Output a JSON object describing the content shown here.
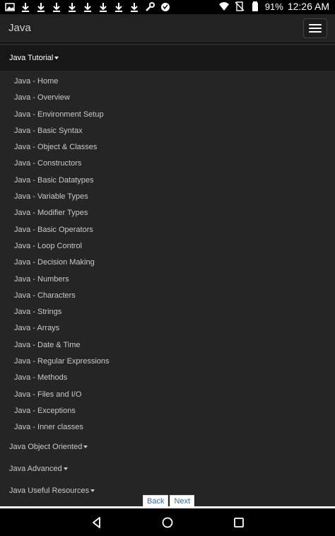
{
  "status_bar": {
    "battery": "91%",
    "time": "12:26 AM",
    "left_icons": [
      "image-icon",
      "download-icon",
      "download-icon",
      "download-icon",
      "download-icon",
      "download-icon",
      "download-icon",
      "download-icon",
      "download-icon",
      "wrench-icon",
      "voicemail-icon"
    ]
  },
  "header": {
    "title": "Java"
  },
  "tutorial": {
    "label": "Java Tutorial",
    "items": [
      "Java - Home",
      "Java - Overview",
      "Java - Environment Setup",
      "Java - Basic Syntax",
      "Java - Object & Classes",
      "Java - Constructors",
      "Java - Basic Datatypes",
      "Java - Variable Types",
      "Java - Modifier Types",
      "Java - Basic Operators",
      "Java - Loop Control",
      "Java - Decision Making",
      "Java - Numbers",
      "Java - Characters",
      "Java - Strings",
      "Java - Arrays",
      "Java - Date & Time",
      "Java - Regular Expressions",
      "Java - Methods",
      "Java - Files and I/O",
      "Java - Exceptions",
      "Java - Inner classes"
    ]
  },
  "sections": [
    {
      "label": "Java Object Oriented"
    },
    {
      "label": "Java Advanced"
    },
    {
      "label": "Java Useful Resources"
    }
  ],
  "pager": {
    "back": "Back",
    "next": "Next"
  },
  "colors": {
    "link": "#2a6ebb",
    "menu_bg": "#252525",
    "header_bg": "#222222"
  }
}
